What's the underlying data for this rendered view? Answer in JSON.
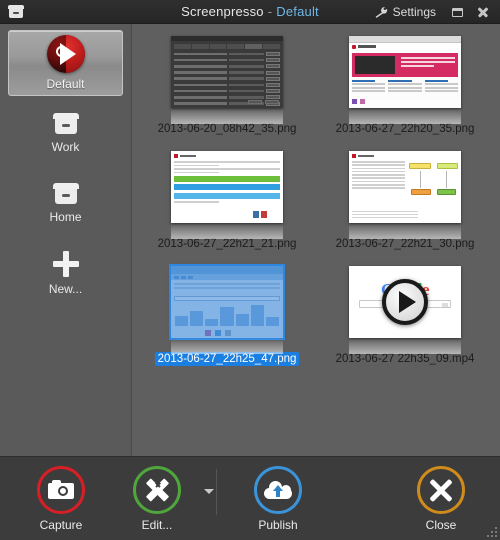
{
  "titlebar": {
    "app_icon": "drawer-icon",
    "app_name": "Screenpresso",
    "separator": "-",
    "profile": "Default",
    "settings_label": "Settings",
    "settings_icon": "wrench-icon",
    "minimize_icon": "minimize-icon",
    "close_icon": "close-icon"
  },
  "sidebar": {
    "items": [
      {
        "label": "Default",
        "icon": "red-play-disc-icon",
        "selected": true
      },
      {
        "label": "Work",
        "icon": "drawer-icon",
        "selected": false
      },
      {
        "label": "Home",
        "icon": "drawer-icon",
        "selected": false
      },
      {
        "label": "New...",
        "icon": "plus-icon",
        "selected": false
      }
    ]
  },
  "grid": {
    "items": [
      {
        "filename": "2013-06-20_08h42_35.png",
        "kind": "image",
        "art": "dialog",
        "selected": false
      },
      {
        "filename": "2013-06-27_22h20_35.png",
        "kind": "image",
        "art": "web",
        "selected": false
      },
      {
        "filename": "2013-06-27_22h21_21.png",
        "kind": "image",
        "art": "bars",
        "selected": false
      },
      {
        "filename": "2013-06-27_22h21_30.png",
        "kind": "image",
        "art": "flow",
        "selected": false
      },
      {
        "filename": "2013-06-27_22h25_47.png",
        "kind": "image",
        "art": "blue",
        "selected": true
      },
      {
        "filename": "2013-06-27 22h35_09.mp4",
        "kind": "video",
        "art": "video",
        "selected": false
      }
    ]
  },
  "toolbar": {
    "capture_label": "Capture",
    "capture_icon": "camera-icon",
    "capture_color": "#d81f26",
    "edit_label": "Edit...",
    "edit_icon": "brush-pencil-icon",
    "edit_color": "#4fa63c",
    "edit_dropdown_icon": "chevron-down-icon",
    "publish_label": "Publish",
    "publish_icon": "cloud-upload-icon",
    "publish_color": "#3b93d8",
    "close_label": "Close",
    "close_icon": "x-icon",
    "close_color": "#cf8b1c"
  },
  "resize_grip_icon": "resize-grip-icon",
  "colors": {
    "window_bg": "#5c5c5c",
    "titlebar_bg": "#2b2b2b",
    "toolbar_bg": "#3c3c3c",
    "selection_blue": "#1a7fe0",
    "profile_text": "#6fb7e8"
  }
}
